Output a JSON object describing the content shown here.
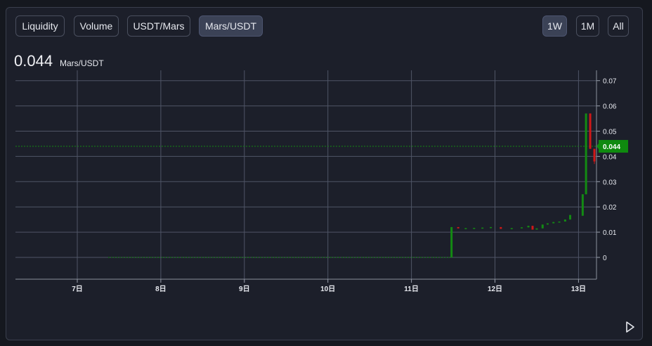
{
  "tabs": [
    {
      "label": "Liquidity",
      "active": false
    },
    {
      "label": "Volume",
      "active": false
    },
    {
      "label": "USDT/Mars",
      "active": false
    },
    {
      "label": "Mars/USDT",
      "active": true
    }
  ],
  "ranges": [
    {
      "label": "1W",
      "active": true
    },
    {
      "label": "1M",
      "active": false
    },
    {
      "label": "All",
      "active": false
    }
  ],
  "price": {
    "value": "0.044",
    "unit": "Mars/USDT"
  },
  "chart_data": {
    "type": "candlestick",
    "x_ticks": [
      "7日",
      "8日",
      "9日",
      "10日",
      "11日",
      "12日",
      "13日"
    ],
    "y_ticks": [
      "0.07",
      "0.06",
      "0.05",
      "0.04",
      "0.03",
      "0.02",
      "0.01",
      "0"
    ],
    "ylim": [
      -0.008,
      0.072
    ],
    "current_price_label": "0.044",
    "current_price": 0.044,
    "flat_line": {
      "from_day": 7.37,
      "to_day": 11.48,
      "value": 0
    },
    "candles": [
      {
        "t": 11.48,
        "o": 0.0,
        "c": 0.012,
        "h": 0.012,
        "l": 0.0
      },
      {
        "t": 11.56,
        "o": 0.012,
        "c": 0.0115,
        "h": 0.012,
        "l": 0.0115
      },
      {
        "t": 11.65,
        "o": 0.0115,
        "c": 0.0116,
        "h": 0.0116,
        "l": 0.0115
      },
      {
        "t": 11.75,
        "o": 0.0116,
        "c": 0.0117,
        "h": 0.0117,
        "l": 0.0116
      },
      {
        "t": 11.85,
        "o": 0.0117,
        "c": 0.0118,
        "h": 0.0118,
        "l": 0.0117
      },
      {
        "t": 11.95,
        "o": 0.0118,
        "c": 0.012,
        "h": 0.012,
        "l": 0.0118
      },
      {
        "t": 12.07,
        "o": 0.012,
        "c": 0.0113,
        "h": 0.012,
        "l": 0.0113
      },
      {
        "t": 12.2,
        "o": 0.0113,
        "c": 0.0116,
        "h": 0.0116,
        "l": 0.0113
      },
      {
        "t": 12.32,
        "o": 0.0116,
        "c": 0.0119,
        "h": 0.0119,
        "l": 0.0116
      },
      {
        "t": 12.4,
        "o": 0.0119,
        "c": 0.0125,
        "h": 0.0125,
        "l": 0.0119
      },
      {
        "t": 12.45,
        "o": 0.0125,
        "c": 0.011,
        "h": 0.0125,
        "l": 0.011
      },
      {
        "t": 12.5,
        "o": 0.011,
        "c": 0.0115,
        "h": 0.0115,
        "l": 0.011
      },
      {
        "t": 12.57,
        "o": 0.0115,
        "c": 0.013,
        "h": 0.013,
        "l": 0.0115
      },
      {
        "t": 12.63,
        "o": 0.013,
        "c": 0.0135,
        "h": 0.0135,
        "l": 0.013
      },
      {
        "t": 12.7,
        "o": 0.0135,
        "c": 0.014,
        "h": 0.014,
        "l": 0.0135
      },
      {
        "t": 12.77,
        "o": 0.014,
        "c": 0.0142,
        "h": 0.0142,
        "l": 0.014
      },
      {
        "t": 12.84,
        "o": 0.0142,
        "c": 0.015,
        "h": 0.015,
        "l": 0.0142
      },
      {
        "t": 12.9,
        "o": 0.015,
        "c": 0.0168,
        "h": 0.0168,
        "l": 0.015
      },
      {
        "t": 13.05,
        "o": 0.0165,
        "c": 0.025,
        "h": 0.025,
        "l": 0.0165
      },
      {
        "t": 13.09,
        "o": 0.025,
        "c": 0.057,
        "h": 0.057,
        "l": 0.025
      },
      {
        "t": 13.14,
        "o": 0.057,
        "c": 0.043,
        "h": 0.057,
        "l": 0.043
      },
      {
        "t": 13.19,
        "o": 0.043,
        "c": 0.038,
        "h": 0.043,
        "l": 0.037
      }
    ]
  },
  "colors": {
    "up": "#138a13",
    "down": "#d01818",
    "grid": "#4f5566",
    "axis_text": "#e6e8ee",
    "price_tag": "#0f8a0f"
  }
}
